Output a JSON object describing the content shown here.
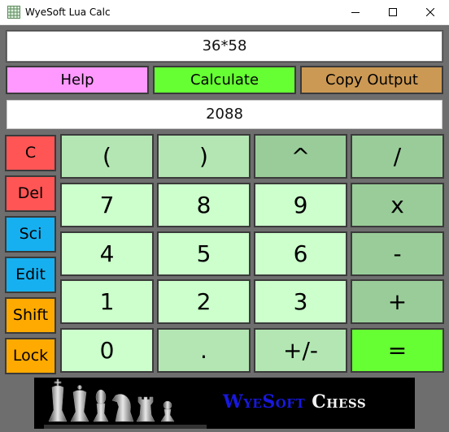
{
  "window": {
    "title": "WyeSoft Lua Calc",
    "icons": [
      "app-grid-icon",
      "minimize-icon",
      "maximize-icon",
      "close-icon"
    ]
  },
  "expression": {
    "value": "36*58"
  },
  "actions": {
    "help": "Help",
    "calculate": "Calculate",
    "copy_output": "Copy Output"
  },
  "output": {
    "value": "2088"
  },
  "side_buttons": {
    "c": "C",
    "del": "Del",
    "sci": "Sci",
    "edit": "Edit",
    "shift": "Shift",
    "lock": "Lock"
  },
  "keypad": {
    "open_paren": "(",
    "close_paren": ")",
    "power": "^",
    "divide": "/",
    "seven": "7",
    "eight": "8",
    "nine": "9",
    "multiply": "x",
    "four": "4",
    "five": "5",
    "six": "6",
    "subtract": "-",
    "one": "1",
    "two": "2",
    "three": "3",
    "add": "+",
    "zero": "0",
    "decimal": ".",
    "negate": "+/-",
    "equals": "="
  },
  "banner": {
    "brand_part1": "WyeSoft",
    "brand_part2": "Chess",
    "image": "chess-pieces-icon"
  },
  "colors": {
    "help": "#ff99ff",
    "calculate": "#66ff33",
    "copy_output": "#cc9954",
    "side_red": "#ff5555",
    "side_blue": "#16b0f0",
    "side_orange": "#ffaa00",
    "key_light": "#ccffcc",
    "key_mid": "#b3e6b3",
    "key_dark": "#99cc99",
    "key_equals": "#66ff33",
    "brand_blue": "#1818dd"
  }
}
